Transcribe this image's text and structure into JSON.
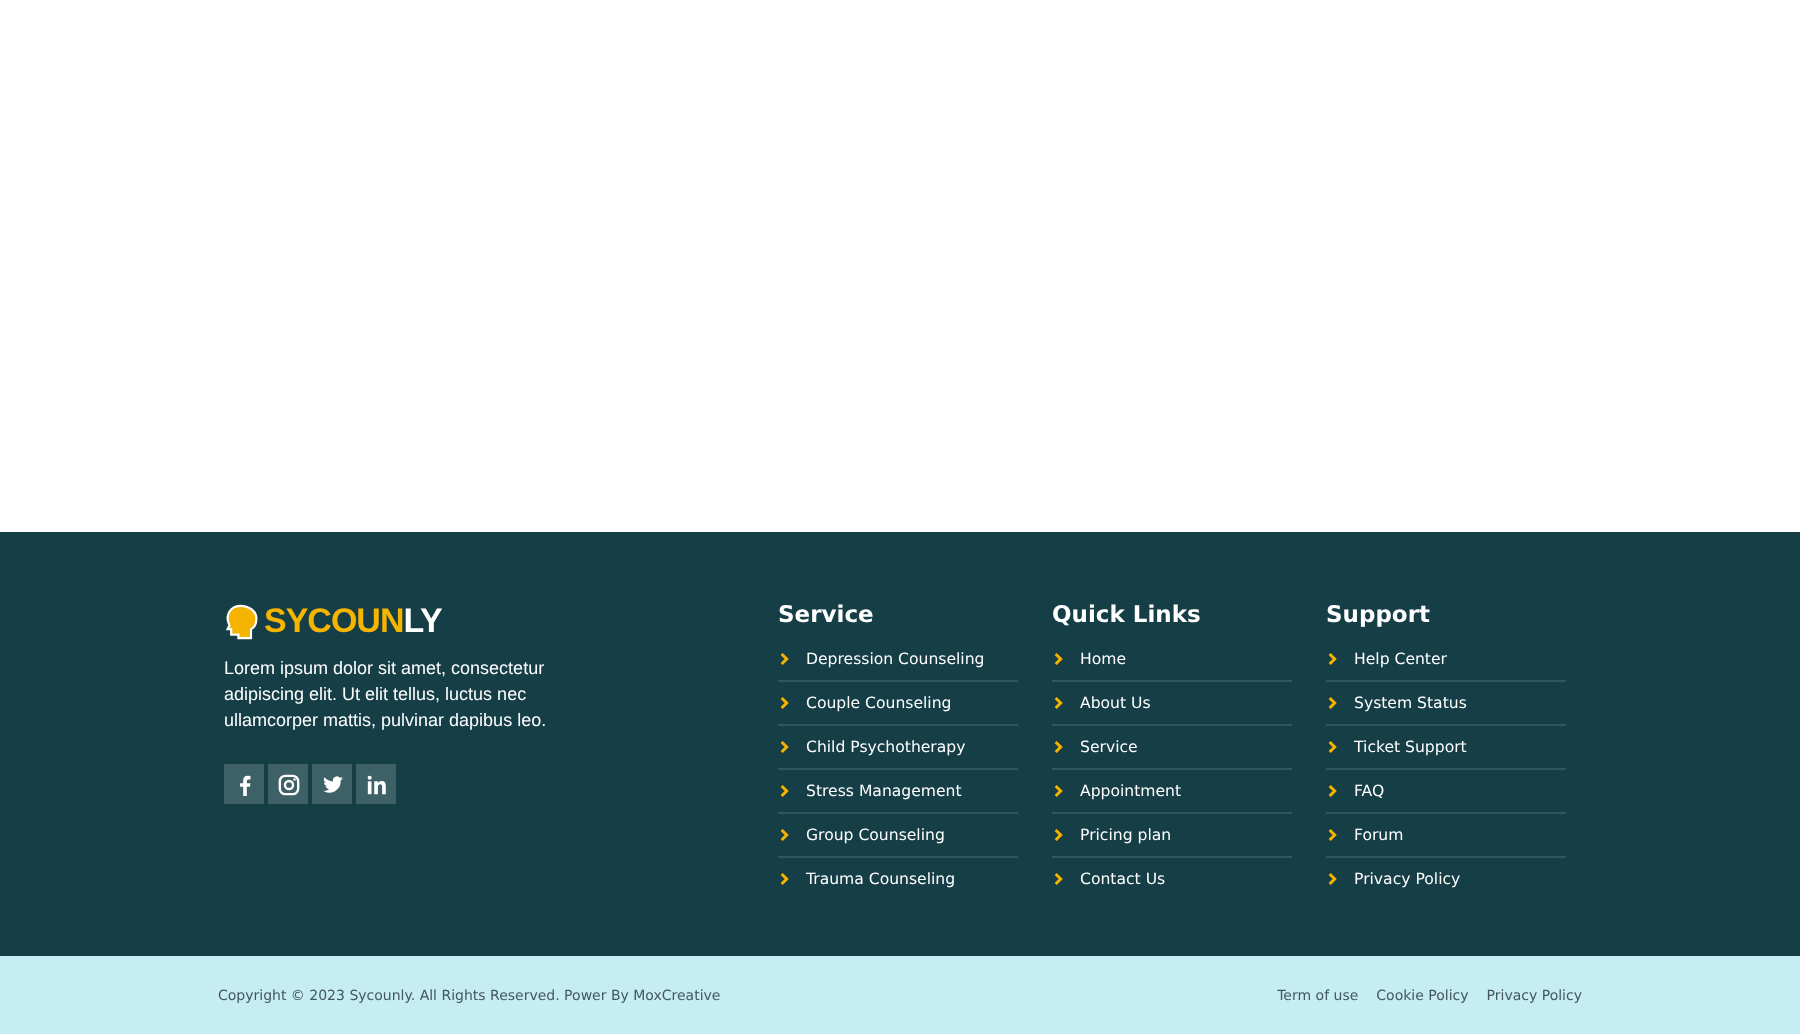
{
  "brand": {
    "logo_accent": "SYCOUN",
    "logo_rest": "LY",
    "description": "Lorem ipsum dolor sit amet, consectetur adipiscing elit. Ut elit tellus, luctus nec ullamcorper mattis, pulvinar dapibus leo."
  },
  "social": [
    {
      "kind": "facebook"
    },
    {
      "kind": "instagram"
    },
    {
      "kind": "twitter"
    },
    {
      "kind": "linkedin"
    }
  ],
  "columns": [
    {
      "title": "Service",
      "links": [
        "Depression Counseling",
        "Couple Counseling",
        "Child Psychotherapy",
        "Stress Management",
        "Group Counseling",
        "Trauma Counseling"
      ]
    },
    {
      "title": "Quick Links",
      "links": [
        "Home",
        "About Us",
        "Service",
        "Appointment",
        "Pricing plan",
        "Contact Us"
      ]
    },
    {
      "title": "Support",
      "links": [
        "Help Center",
        "System Status",
        "Ticket Support",
        "FAQ",
        "Forum",
        "Privacy Policy"
      ]
    }
  ],
  "bottom_bar": {
    "copyright": "Copyright © 2023 Sycounly. All Rights Reserved. Power By MoxCreative",
    "links": [
      "Term of use",
      "Cookie Policy",
      "Privacy Policy"
    ]
  }
}
